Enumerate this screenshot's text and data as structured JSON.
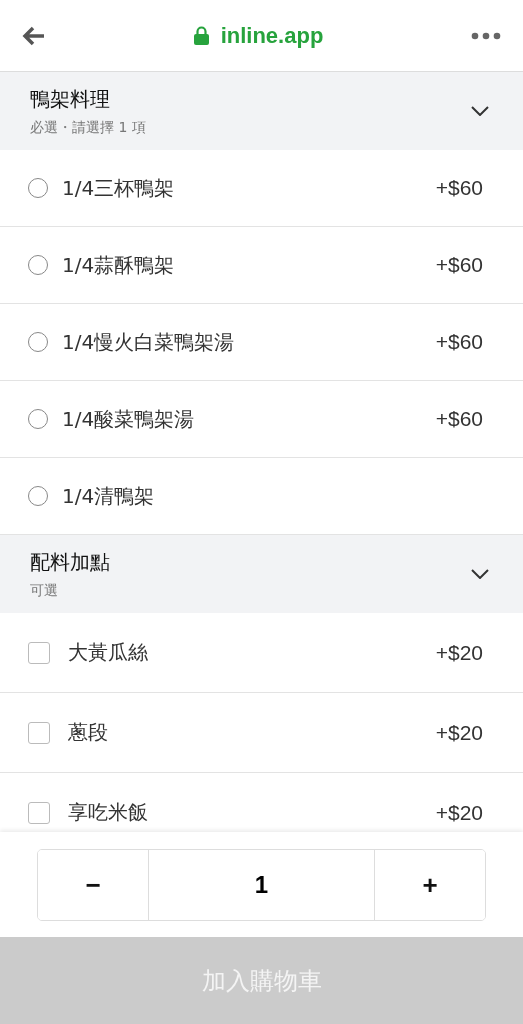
{
  "browser_bar": {
    "url": "inline.app",
    "secure": true
  },
  "sections": [
    {
      "title": "鴨架料理",
      "subtitle": "必選・請選擇 1 項",
      "expanded": true,
      "kind": "radio",
      "options": [
        {
          "name": "1/4三杯鴨架",
          "price": "+$60",
          "selected": false
        },
        {
          "name": "1/4蒜酥鴨架",
          "price": "+$60",
          "selected": false
        },
        {
          "name": "1/4慢火白菜鴨架湯",
          "price": "+$60",
          "selected": false
        },
        {
          "name": "1/4酸菜鴨架湯",
          "price": "+$60",
          "selected": false
        },
        {
          "name": "1/4清鴨架",
          "selected": false
        }
      ]
    },
    {
      "title": "配料加點",
      "subtitle": "可選",
      "expanded": true,
      "kind": "checkbox",
      "options": [
        {
          "name": "大黃瓜絲",
          "price": "+$20",
          "selected": false
        },
        {
          "name": "蔥段",
          "price": "+$20",
          "selected": false
        },
        {
          "name": "享吃米飯",
          "price": "+$20",
          "selected": false
        }
      ]
    }
  ],
  "quantity": {
    "minus": "−",
    "value": "1",
    "plus": "+"
  },
  "add_to_cart": {
    "label": "加入購物車",
    "disabled": true
  }
}
